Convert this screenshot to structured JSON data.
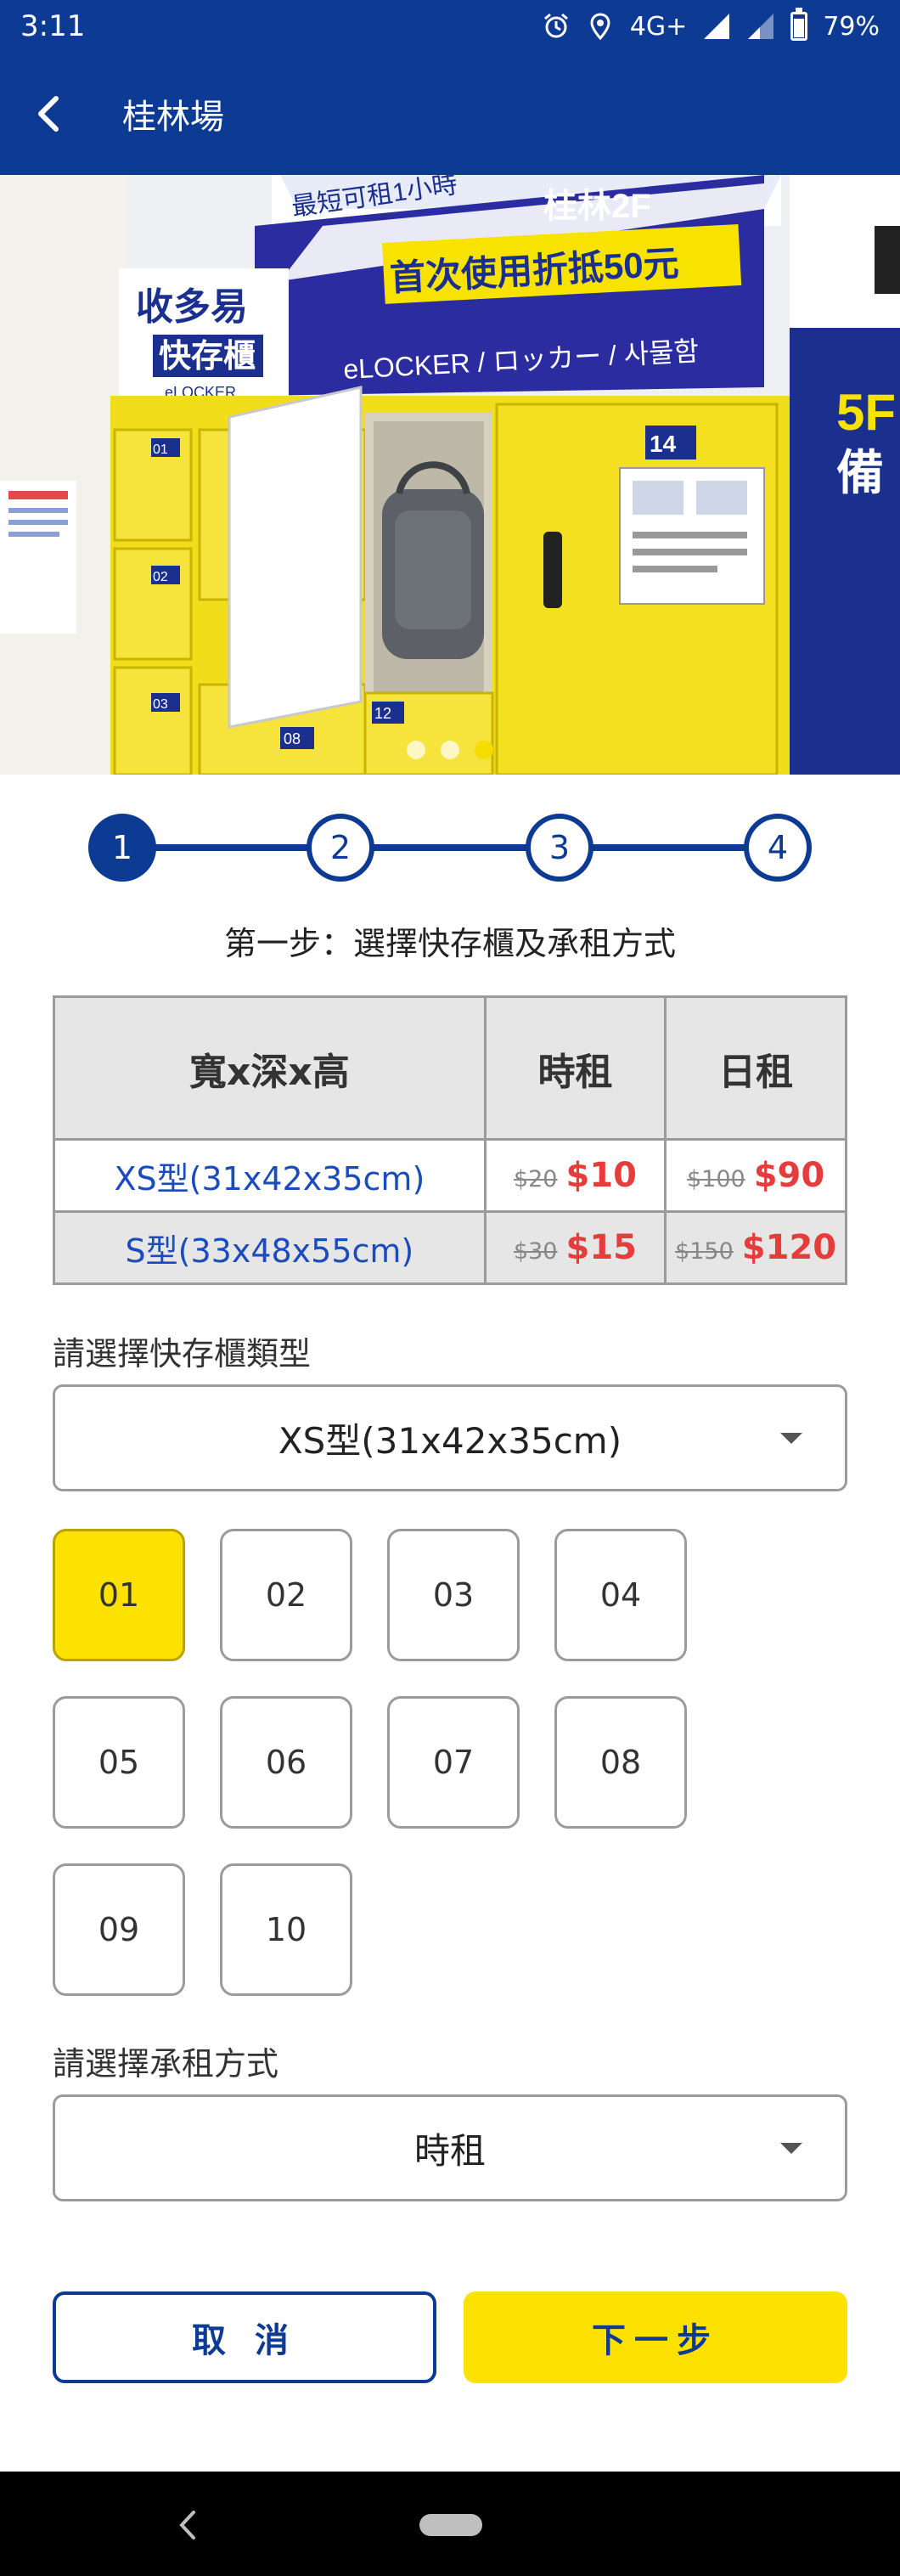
{
  "status_bar": {
    "time": "3:11",
    "network": "4G+",
    "battery": "79%",
    "icons": [
      "alarm-icon",
      "location-icon",
      "signal-icon",
      "signal-weak-icon",
      "battery-icon"
    ]
  },
  "header": {
    "title": "桂林場",
    "back_icon": "chevron-left-icon"
  },
  "hero": {
    "slide_count": 3,
    "active_slide": 3,
    "photo": {
      "sign_top": "最短可租1小時",
      "sign_location": "桂林2F",
      "brand_name": "收多易",
      "brand_sub": "快存櫃",
      "brand_en": "eLOCKER",
      "promo": "首次使用折抵50元",
      "languages": "eLOCKER / ロッカー / 사물함",
      "locker_tags": [
        "01",
        "02",
        "03",
        "08",
        "12",
        "14"
      ],
      "side_text": "5F",
      "side_text2": "備"
    }
  },
  "stepper": {
    "steps": [
      "1",
      "2",
      "3",
      "4"
    ],
    "current": 1
  },
  "step_title": "第一步：選擇快存櫃及承租方式",
  "pricing": {
    "headers": [
      "寬x深x高",
      "時租",
      "日租"
    ],
    "rows": [
      {
        "size": "XS型(31x42x35cm)",
        "hourly_old": "$20",
        "hourly_new": "$10",
        "daily_old": "$100",
        "daily_new": "$90"
      },
      {
        "size": "S型(33x48x55cm)",
        "hourly_old": "$30",
        "hourly_new": "$15",
        "daily_old": "$150",
        "daily_new": "$120"
      }
    ]
  },
  "locker_type": {
    "label": "請選擇快存櫃類型",
    "selected": "XS型(31x42x35cm)"
  },
  "lockers": {
    "items": [
      "01",
      "02",
      "03",
      "04",
      "05",
      "06",
      "07",
      "08",
      "09",
      "10"
    ],
    "selected": "01"
  },
  "rent_type": {
    "label": "請選擇承租方式",
    "selected": "時租"
  },
  "buttons": {
    "cancel": "取 消",
    "next": "下一步"
  },
  "colors": {
    "primary": "#0d3a92",
    "accent_yellow": "#fde100",
    "price_red": "#e63c3c",
    "link_blue": "#1b4bbd"
  }
}
